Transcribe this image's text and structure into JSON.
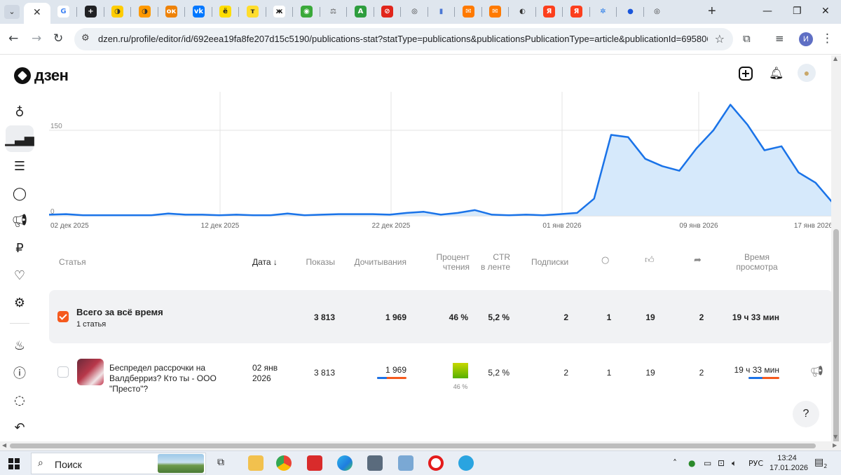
{
  "browser": {
    "tab_close": "✕",
    "favicons": [
      {
        "icon": "google-icon",
        "color": "#ffffff",
        "glyph": "G",
        "fg": "#4285f4"
      },
      {
        "icon": "plus-box-icon",
        "color": "#202124",
        "glyph": "+",
        "fg": "#ffffff"
      },
      {
        "icon": "yandex-music-icon",
        "color": "#ffcc00",
        "glyph": "◑",
        "fg": "#333333"
      },
      {
        "icon": "yandex-music-icon",
        "color": "#ff9900",
        "glyph": "◑",
        "fg": "#333333"
      },
      {
        "icon": "odnoklassniki-icon",
        "color": "#ee8208",
        "glyph": "ок",
        "fg": "#ffffff"
      },
      {
        "icon": "vk-icon",
        "color": "#0077ff",
        "glyph": "vk",
        "fg": "#ffffff"
      },
      {
        "icon": "yo-icon",
        "color": "#ffdd00",
        "glyph": "ё",
        "fg": "#222222"
      },
      {
        "icon": "t-icon",
        "color": "#ffdd2d",
        "glyph": "т",
        "fg": "#222222"
      },
      {
        "icon": "zhzh-icon",
        "color": "#ffffff",
        "glyph": "ж",
        "fg": "#111111"
      },
      {
        "icon": "game-icon",
        "color": "#3aa93a",
        "glyph": "◉",
        "fg": "#ffffff"
      },
      {
        "icon": "scales-icon",
        "color": "#dfe6ee",
        "glyph": "⚖",
        "fg": "#555555"
      },
      {
        "icon": "letter-a-icon",
        "color": "#2e9e3e",
        "glyph": "A",
        "fg": "#ffffff"
      },
      {
        "icon": "no-entry-icon",
        "color": "#e1261c",
        "glyph": "⊘",
        "fg": "#ffffff"
      },
      {
        "icon": "chrome-icon",
        "color": "#dfe6ee",
        "glyph": "◎",
        "fg": "#333333"
      },
      {
        "icon": "chart-icon",
        "color": "#dfe6ee",
        "glyph": "▮",
        "fg": "#4a77d4"
      },
      {
        "icon": "mail-icon",
        "color": "#ff7a00",
        "glyph": "✉",
        "fg": "#ffffff"
      },
      {
        "icon": "mail-icon",
        "color": "#ff7a00",
        "glyph": "✉",
        "fg": "#ffffff"
      },
      {
        "icon": "globe-icon",
        "color": "#dfe6ee",
        "glyph": "◐",
        "fg": "#333333"
      },
      {
        "icon": "yandex-icon",
        "color": "#fc3f1d",
        "glyph": "Я",
        "fg": "#ffffff"
      },
      {
        "icon": "yandex-icon",
        "color": "#fc3f1d",
        "glyph": "Я",
        "fg": "#ffffff"
      },
      {
        "icon": "gear-icon",
        "color": "#dfe6ee",
        "glyph": "✲",
        "fg": "#1a73e8"
      },
      {
        "icon": "dot-icon",
        "color": "#dfe6ee",
        "glyph": "●",
        "fg": "#1a56db"
      },
      {
        "icon": "chrome-icon",
        "color": "#dfe6ee",
        "glyph": "◎",
        "fg": "#333333"
      }
    ],
    "new_tab": "+",
    "url": "dzen.ru/profile/editor/id/692eea19fa8fe207d15c5190/publications-stat?statType=publications&publicationsPublicationType=article&publicationId=69580695...",
    "profile_initial": "И"
  },
  "dzen": {
    "logo_text": "дзен"
  },
  "chart_data": {
    "type": "area",
    "series": [
      {
        "values": [
          2,
          3,
          1,
          1,
          1,
          1,
          1,
          4,
          2,
          2,
          1,
          2,
          1,
          1,
          4,
          1,
          2,
          3,
          3,
          3,
          2,
          5,
          7,
          2,
          5,
          10,
          2,
          1,
          2,
          1,
          3,
          5,
          30,
          142,
          138,
          100,
          87,
          79,
          118,
          150,
          195,
          160,
          115,
          122,
          76,
          58,
          23
        ]
      }
    ],
    "x_labels": [
      "02 дек 2025",
      "12 дек 2025",
      "22 дек 2025",
      "01 янв 2026",
      "09 янв 2026",
      "17 янв 2026"
    ],
    "y_ticks": [
      0,
      150
    ],
    "ylim": [
      0,
      150
    ],
    "ylim_visible_top": 150,
    "grid": true,
    "line_color": "#1a73e8",
    "fill_color": "#d6e9fb"
  },
  "table": {
    "headers": {
      "article": "Статья",
      "date": "Дата",
      "date_sort": "↓",
      "shows": "Показы",
      "reads": "Дочитывания",
      "percent_1": "Процент",
      "percent_2": "чтения",
      "ctr_1": "CTR",
      "ctr_2": "в ленте",
      "subs": "Подписки",
      "time_1": "Время",
      "time_2": "просмотра"
    },
    "total": {
      "title": "Всего за всё время",
      "subtitle": "1 статья",
      "shows": "3 813",
      "reads": "1 969",
      "percent": "46 %",
      "ctr": "5,2 %",
      "subs": "2",
      "comments": "1",
      "likes": "19",
      "reposts": "2",
      "time": "19 ч 33 мин"
    },
    "rows": [
      {
        "title": "Беспредел рассрочки на Валдберриз? Кто ты - ООО \"Престо\"?",
        "date": "02 янв 2026",
        "shows": "3 813",
        "reads": "1 969",
        "percent": "46 %",
        "ctr": "5,2 %",
        "subs": "2",
        "comments": "1",
        "likes": "19",
        "reposts": "2",
        "time": "19 ч 33 мин"
      }
    ]
  },
  "help_label": "?",
  "taskbar": {
    "search_label": "Поиск",
    "lang": "РУС",
    "time": "13:24",
    "date": "17.01.2026",
    "notifications": "2"
  }
}
